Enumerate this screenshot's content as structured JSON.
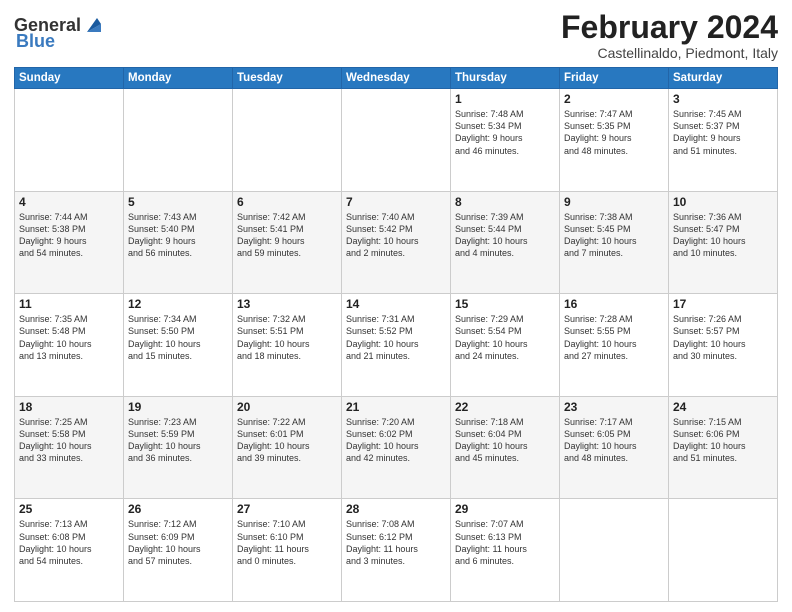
{
  "header": {
    "logo_general": "General",
    "logo_blue": "Blue",
    "month_title": "February 2024",
    "location": "Castellinaldo, Piedmont, Italy"
  },
  "weekdays": [
    "Sunday",
    "Monday",
    "Tuesday",
    "Wednesday",
    "Thursday",
    "Friday",
    "Saturday"
  ],
  "weeks": [
    [
      {
        "day": "",
        "text": ""
      },
      {
        "day": "",
        "text": ""
      },
      {
        "day": "",
        "text": ""
      },
      {
        "day": "",
        "text": ""
      },
      {
        "day": "1",
        "text": "Sunrise: 7:48 AM\nSunset: 5:34 PM\nDaylight: 9 hours\nand 46 minutes."
      },
      {
        "day": "2",
        "text": "Sunrise: 7:47 AM\nSunset: 5:35 PM\nDaylight: 9 hours\nand 48 minutes."
      },
      {
        "day": "3",
        "text": "Sunrise: 7:45 AM\nSunset: 5:37 PM\nDaylight: 9 hours\nand 51 minutes."
      }
    ],
    [
      {
        "day": "4",
        "text": "Sunrise: 7:44 AM\nSunset: 5:38 PM\nDaylight: 9 hours\nand 54 minutes."
      },
      {
        "day": "5",
        "text": "Sunrise: 7:43 AM\nSunset: 5:40 PM\nDaylight: 9 hours\nand 56 minutes."
      },
      {
        "day": "6",
        "text": "Sunrise: 7:42 AM\nSunset: 5:41 PM\nDaylight: 9 hours\nand 59 minutes."
      },
      {
        "day": "7",
        "text": "Sunrise: 7:40 AM\nSunset: 5:42 PM\nDaylight: 10 hours\nand 2 minutes."
      },
      {
        "day": "8",
        "text": "Sunrise: 7:39 AM\nSunset: 5:44 PM\nDaylight: 10 hours\nand 4 minutes."
      },
      {
        "day": "9",
        "text": "Sunrise: 7:38 AM\nSunset: 5:45 PM\nDaylight: 10 hours\nand 7 minutes."
      },
      {
        "day": "10",
        "text": "Sunrise: 7:36 AM\nSunset: 5:47 PM\nDaylight: 10 hours\nand 10 minutes."
      }
    ],
    [
      {
        "day": "11",
        "text": "Sunrise: 7:35 AM\nSunset: 5:48 PM\nDaylight: 10 hours\nand 13 minutes."
      },
      {
        "day": "12",
        "text": "Sunrise: 7:34 AM\nSunset: 5:50 PM\nDaylight: 10 hours\nand 15 minutes."
      },
      {
        "day": "13",
        "text": "Sunrise: 7:32 AM\nSunset: 5:51 PM\nDaylight: 10 hours\nand 18 minutes."
      },
      {
        "day": "14",
        "text": "Sunrise: 7:31 AM\nSunset: 5:52 PM\nDaylight: 10 hours\nand 21 minutes."
      },
      {
        "day": "15",
        "text": "Sunrise: 7:29 AM\nSunset: 5:54 PM\nDaylight: 10 hours\nand 24 minutes."
      },
      {
        "day": "16",
        "text": "Sunrise: 7:28 AM\nSunset: 5:55 PM\nDaylight: 10 hours\nand 27 minutes."
      },
      {
        "day": "17",
        "text": "Sunrise: 7:26 AM\nSunset: 5:57 PM\nDaylight: 10 hours\nand 30 minutes."
      }
    ],
    [
      {
        "day": "18",
        "text": "Sunrise: 7:25 AM\nSunset: 5:58 PM\nDaylight: 10 hours\nand 33 minutes."
      },
      {
        "day": "19",
        "text": "Sunrise: 7:23 AM\nSunset: 5:59 PM\nDaylight: 10 hours\nand 36 minutes."
      },
      {
        "day": "20",
        "text": "Sunrise: 7:22 AM\nSunset: 6:01 PM\nDaylight: 10 hours\nand 39 minutes."
      },
      {
        "day": "21",
        "text": "Sunrise: 7:20 AM\nSunset: 6:02 PM\nDaylight: 10 hours\nand 42 minutes."
      },
      {
        "day": "22",
        "text": "Sunrise: 7:18 AM\nSunset: 6:04 PM\nDaylight: 10 hours\nand 45 minutes."
      },
      {
        "day": "23",
        "text": "Sunrise: 7:17 AM\nSunset: 6:05 PM\nDaylight: 10 hours\nand 48 minutes."
      },
      {
        "day": "24",
        "text": "Sunrise: 7:15 AM\nSunset: 6:06 PM\nDaylight: 10 hours\nand 51 minutes."
      }
    ],
    [
      {
        "day": "25",
        "text": "Sunrise: 7:13 AM\nSunset: 6:08 PM\nDaylight: 10 hours\nand 54 minutes."
      },
      {
        "day": "26",
        "text": "Sunrise: 7:12 AM\nSunset: 6:09 PM\nDaylight: 10 hours\nand 57 minutes."
      },
      {
        "day": "27",
        "text": "Sunrise: 7:10 AM\nSunset: 6:10 PM\nDaylight: 11 hours\nand 0 minutes."
      },
      {
        "day": "28",
        "text": "Sunrise: 7:08 AM\nSunset: 6:12 PM\nDaylight: 11 hours\nand 3 minutes."
      },
      {
        "day": "29",
        "text": "Sunrise: 7:07 AM\nSunset: 6:13 PM\nDaylight: 11 hours\nand 6 minutes."
      },
      {
        "day": "",
        "text": ""
      },
      {
        "day": "",
        "text": ""
      }
    ]
  ]
}
